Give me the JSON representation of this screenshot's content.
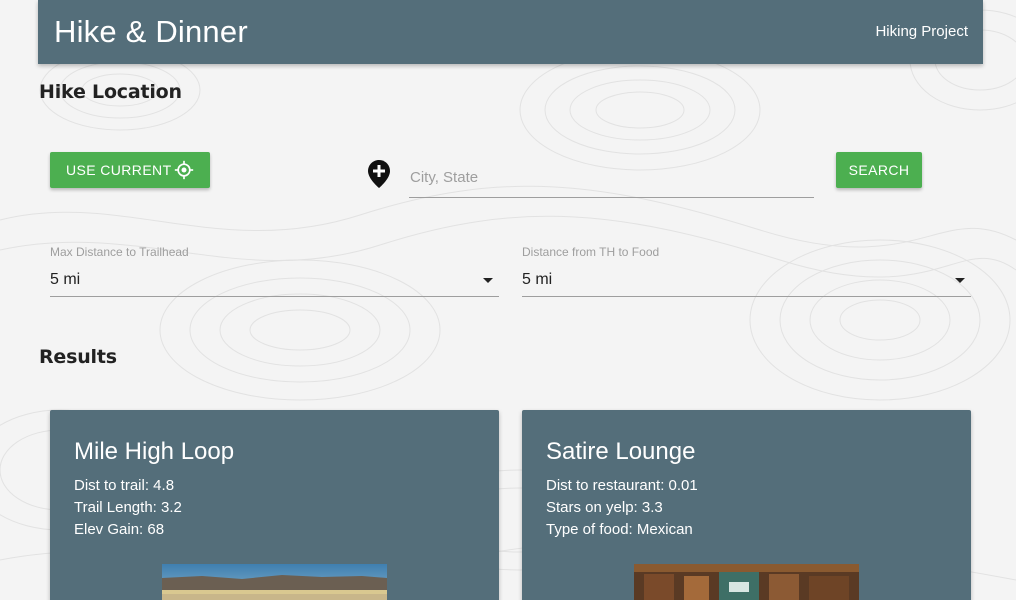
{
  "header": {
    "brand": "Hike & Dinner",
    "nav_link": "Hiking Project"
  },
  "hike_location": {
    "title": "Hike Location",
    "use_current_label": "Use Current",
    "city_placeholder": "City, State",
    "city_value": "",
    "search_label": "Search",
    "max_distance": {
      "label": "Max Distance to Trailhead",
      "value": "5 mi"
    },
    "food_distance": {
      "label": "Distance from TH to Food",
      "value": "5 mi"
    }
  },
  "results": {
    "title": "Results",
    "trail_card": {
      "title": "Mile High Loop",
      "lines": [
        "Dist to trail: 4.8",
        "Trail Length: 3.2",
        "Elev Gain: 68"
      ]
    },
    "restaurant_card": {
      "title": "Satire Lounge",
      "lines": [
        "Dist to restaurant: 0.01",
        "Stars on yelp: 3.3",
        "Type of food: Mexican"
      ]
    }
  },
  "colors": {
    "header_bg": "#546e7a",
    "button_green": "#4caf50",
    "card_bg": "#546e7a"
  },
  "icons": {
    "use_current": "crosshair-icon",
    "location": "add-location-pin-icon",
    "dropdown": "caret-down-icon"
  }
}
